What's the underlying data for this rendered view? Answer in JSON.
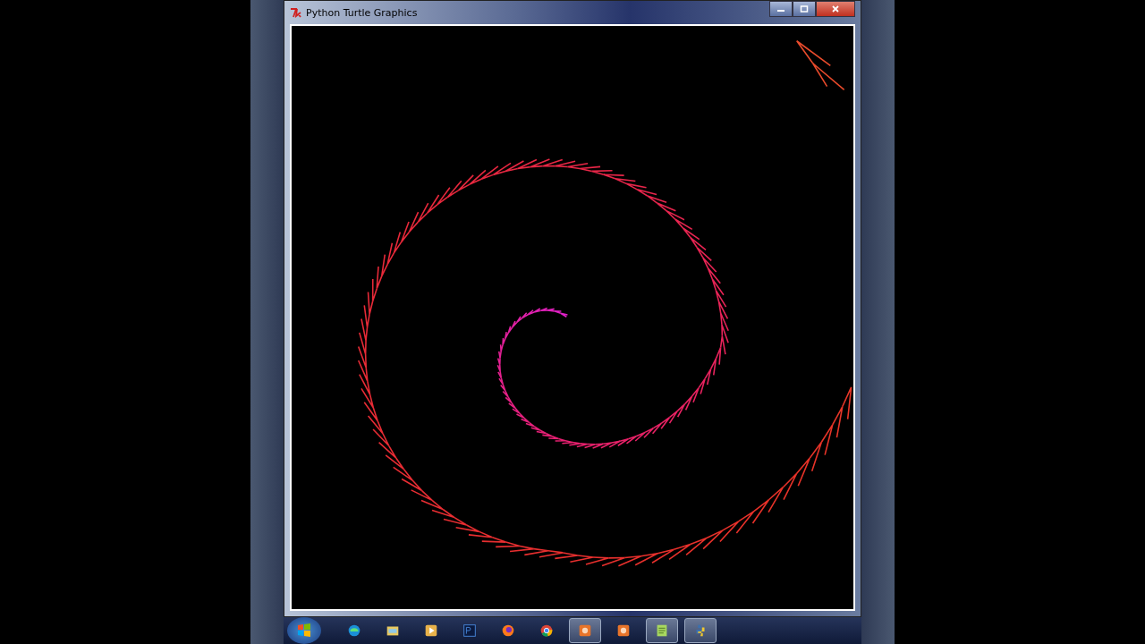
{
  "window": {
    "title": "Python Turtle Graphics"
  },
  "taskbar": {
    "items": [
      {
        "kind": "edge",
        "running": false
      },
      {
        "kind": "folder",
        "running": false
      },
      {
        "kind": "media",
        "running": false
      },
      {
        "kind": "photoshop",
        "running": false
      },
      {
        "kind": "firefox",
        "running": false
      },
      {
        "kind": "chrome",
        "running": false
      },
      {
        "kind": "box",
        "running": true
      },
      {
        "kind": "box",
        "running": false
      },
      {
        "kind": "notepad",
        "running": true
      },
      {
        "kind": "python",
        "running": true
      }
    ]
  }
}
